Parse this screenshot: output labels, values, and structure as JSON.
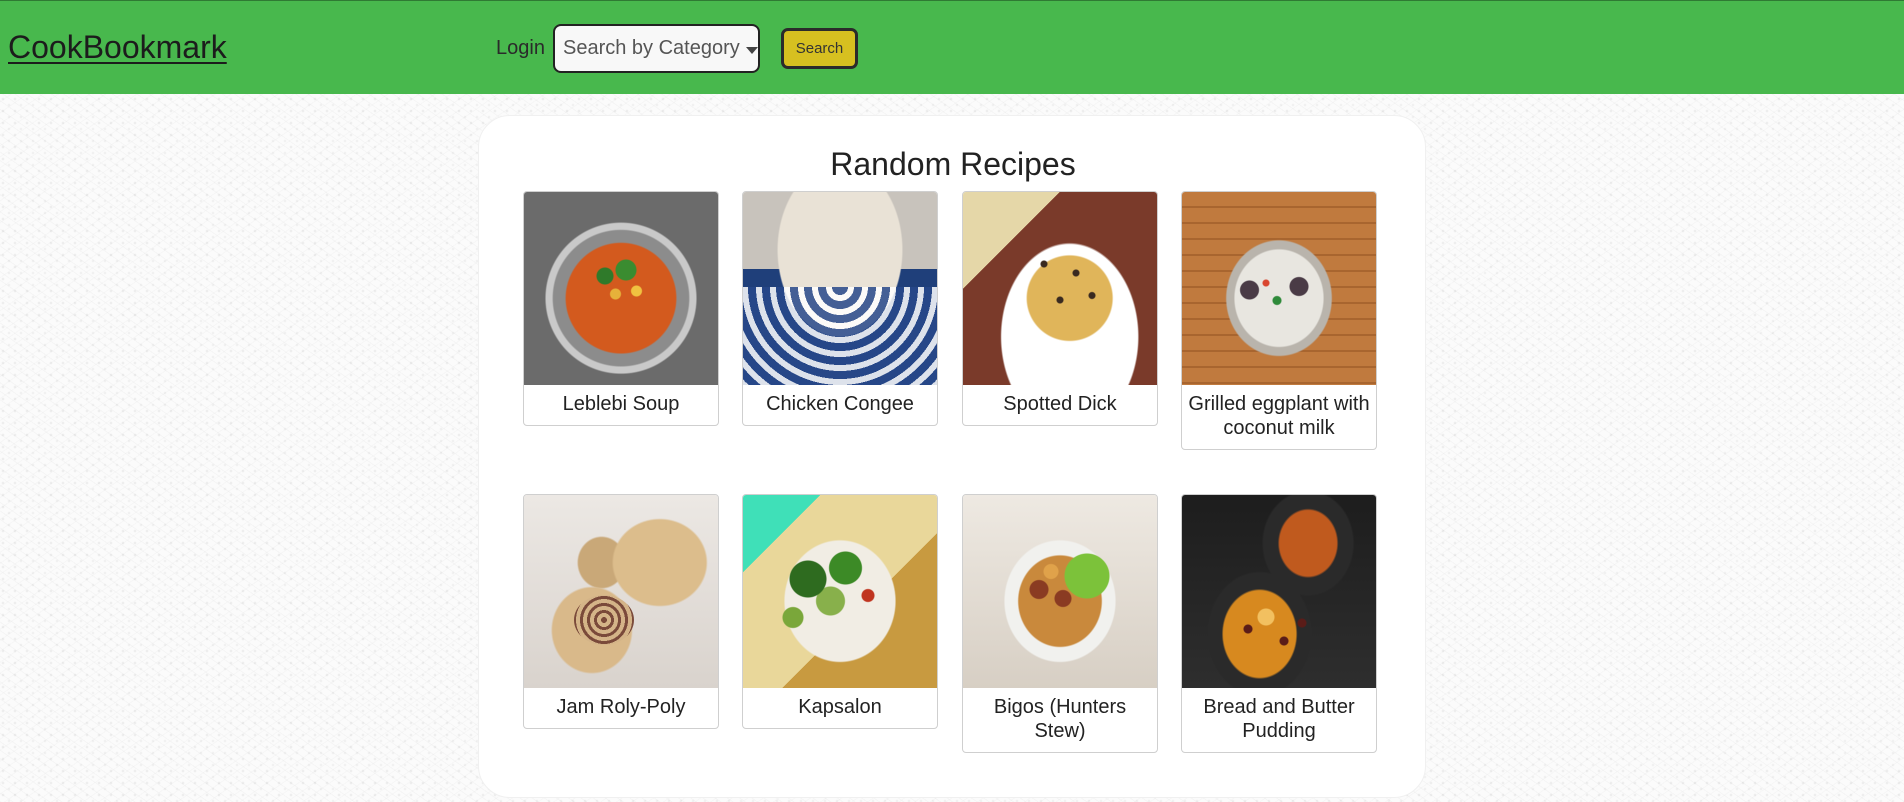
{
  "header": {
    "brand": "CookBookmark",
    "login_label": "Login",
    "category_select": "Search by Category",
    "search_button": "Search",
    "accent_color": "#48b84d",
    "search_button_color": "#d7c020"
  },
  "main": {
    "title": "Random Recipes",
    "recipes": [
      {
        "title": "Leblebi Soup",
        "image": "soup-photo"
      },
      {
        "title": "Chicken Congee",
        "image": "congee-photo"
      },
      {
        "title": "Spotted Dick",
        "image": "pudding-photo"
      },
      {
        "title": "Grilled eggplant with coconut milk",
        "image": "eggplant-photo"
      },
      {
        "title": "Jam Roly-Poly",
        "image": "roly-poly-photo"
      },
      {
        "title": "Kapsalon",
        "image": "kapsalon-photo"
      },
      {
        "title": "Bigos (Hunters Stew)",
        "image": "stew-photo"
      },
      {
        "title": "Bread and Butter Pudding",
        "image": "bread-pudding-photo"
      }
    ]
  }
}
